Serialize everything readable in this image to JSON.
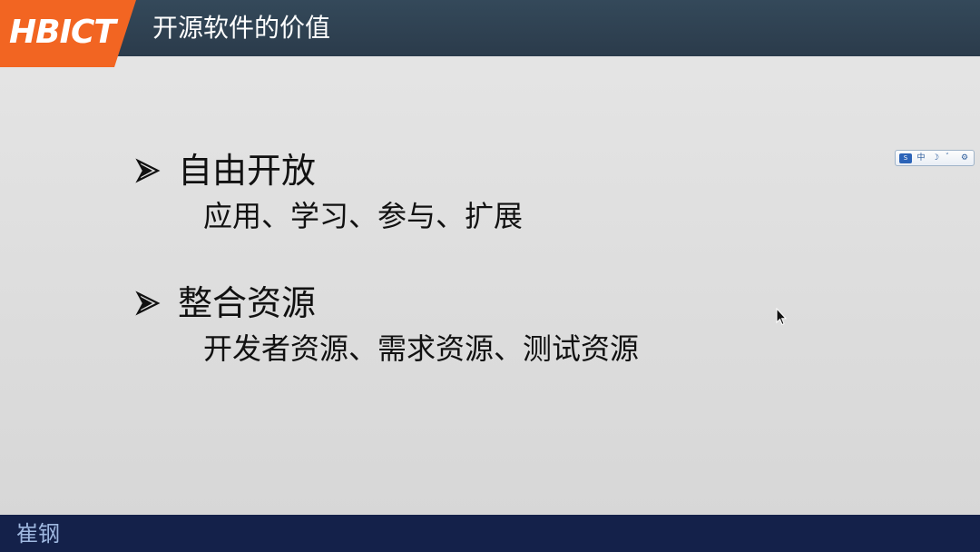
{
  "header": {
    "logo_text": "HBICT",
    "title": "开源软件的价值"
  },
  "content": {
    "bullets": [
      {
        "heading": "自由开放",
        "detail": "应用、学习、参与、扩展"
      },
      {
        "heading": "整合资源",
        "detail": "开发者资源、需求资源、测试资源"
      }
    ]
  },
  "ime_toolbar": {
    "items": [
      "中",
      "☽",
      "゛",
      "⚙"
    ],
    "logo_icon": "ime-logo-icon"
  },
  "footer": {
    "name": "崔钢"
  },
  "colors": {
    "header_bg": "#2b3b4b",
    "logo_bg": "#f26522",
    "footer_bg": "#14214a",
    "footer_text": "#9fb8e0",
    "slide_bg": "#dddddd"
  }
}
